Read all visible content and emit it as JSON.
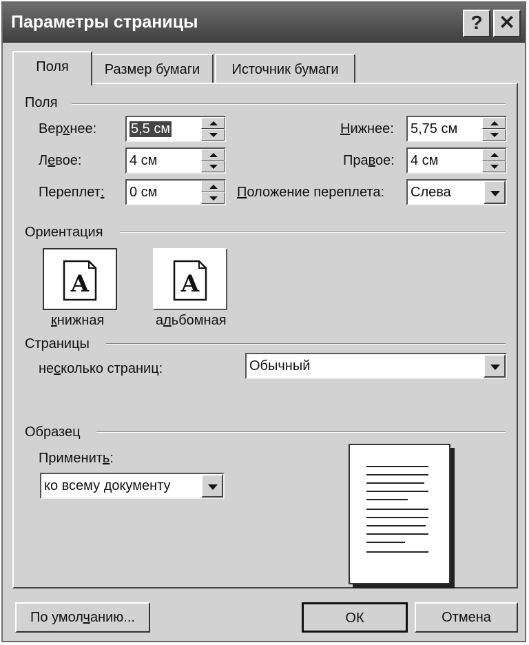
{
  "window": {
    "title": "Параметры страницы",
    "help_label": "?",
    "close_label": "✕"
  },
  "tabs": [
    {
      "label": "Поля",
      "active": true
    },
    {
      "label": "Размер бумаги",
      "active": false
    },
    {
      "label": "Источник бумаги",
      "active": false
    }
  ],
  "margins": {
    "group_label": "Поля",
    "top": {
      "label_a": "Вер",
      "label_u": "х",
      "label_b": "нее:",
      "value": "5,5 см"
    },
    "bottom": {
      "label_a": "",
      "label_u": "Н",
      "label_b": "ижнее:",
      "value": "5,75 см"
    },
    "left": {
      "label_a": "Л",
      "label_u": "е",
      "label_b": "вое:",
      "value": "4 см"
    },
    "right": {
      "label_a": "Пра",
      "label_u": "в",
      "label_b": "ое:",
      "value": "4 см"
    },
    "gutter": {
      "label_a": "Переплет",
      "label_u": ":",
      "label_b": "",
      "value": "0 см"
    },
    "gutter_pos": {
      "label_a": "",
      "label_u": "П",
      "label_b": "оложение переплета:",
      "value": "Слева"
    }
  },
  "orientation": {
    "group_label": "Ориентация",
    "portrait": {
      "label_u": "к",
      "label_b": "нижная",
      "glyph": "A",
      "selected": true
    },
    "landscape": {
      "label_a": "а",
      "label_u": "л",
      "label_b": "ьбомная",
      "glyph": "A",
      "selected": false
    }
  },
  "pages": {
    "group_label": "Страницы",
    "multi_label_a": "не",
    "multi_label_u": "с",
    "multi_label_b": "колько страниц:",
    "value": "Обычный"
  },
  "sample": {
    "group_label": "Образец",
    "apply_label_a": "Применит",
    "apply_label_u": "ь",
    "apply_label_b": ":",
    "apply_value": "ко всему документу"
  },
  "buttons": {
    "default_a": "По умол",
    "default_u": "ч",
    "default_b": "анию...",
    "ok": "ОК",
    "cancel": "Отмена"
  },
  "icons": {
    "help": "help-icon",
    "close": "close-icon",
    "spin_up": "spin-up-icon",
    "spin_down": "spin-down-icon",
    "dropdown": "chevron-down-icon",
    "portrait": "portrait-page-icon",
    "landscape": "landscape-page-icon"
  }
}
